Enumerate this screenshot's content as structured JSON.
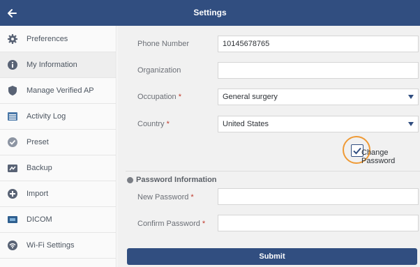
{
  "header": {
    "title": "Settings"
  },
  "sidebar": {
    "items": [
      {
        "label": "Preferences",
        "icon": "gear-icon"
      },
      {
        "label": "My Information",
        "icon": "info-icon",
        "active": true
      },
      {
        "label": "Manage Verified AP",
        "icon": "shield-icon"
      },
      {
        "label": "Activity Log",
        "icon": "list-icon"
      },
      {
        "label": "Preset",
        "icon": "check-circle-icon"
      },
      {
        "label": "Backup",
        "icon": "backup-icon"
      },
      {
        "label": "Import",
        "icon": "plus-circle-icon"
      },
      {
        "label": "DICOM",
        "icon": "dicom-icon"
      },
      {
        "label": "Wi-Fi Settings",
        "icon": "wifi-icon"
      }
    ]
  },
  "form": {
    "phone": {
      "label": "Phone Number",
      "value": "10145678765"
    },
    "organization": {
      "label": "Organization",
      "value": ""
    },
    "occupation": {
      "label": "Occupation",
      "required": "*",
      "value": "General surgery"
    },
    "country": {
      "label": "Country",
      "required": "*",
      "value": "United States"
    },
    "change_password": {
      "label": "Change Password",
      "checked": true
    },
    "password_section": {
      "title": "Password Information"
    },
    "new_password": {
      "label": "New Password",
      "required": "*",
      "value": ""
    },
    "confirm_password": {
      "label": "Confirm Password",
      "required": "*",
      "value": ""
    },
    "submit_label": "Submit"
  },
  "colors": {
    "header": "#314e80",
    "accent": "#ef9a35",
    "required": "#c0392b"
  }
}
